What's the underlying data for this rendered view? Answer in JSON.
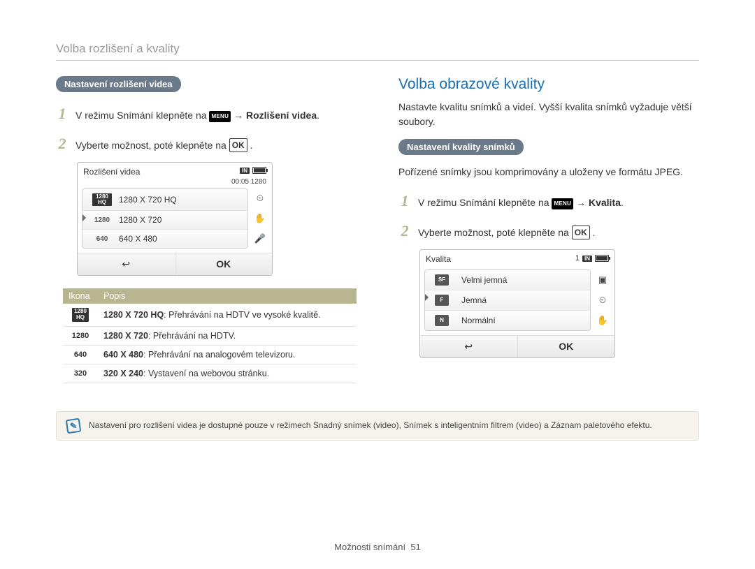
{
  "page_heading": "Volba rozlišení a kvality",
  "left": {
    "pill": "Nastavení rozlišení videa",
    "step1_pre": "V režimu Snímání klepněte na",
    "step1_menu": "MENU",
    "step1_post": "→ Rozlišení videa",
    "step2_pre": "Vyberte možnost, poté klepněte na",
    "step2_ok": "OK",
    "lcd": {
      "title": "Rozlišení videa",
      "in_label": "IN",
      "sub": "00:05  1280",
      "rows": [
        {
          "icon": "1280\nHQ",
          "label": "1280 X 720 HQ",
          "hq": true,
          "selected": false
        },
        {
          "icon": "1280",
          "label": "1280 X 720",
          "hq": false,
          "selected": true
        },
        {
          "icon": "640",
          "label": "640 X 480",
          "hq": false,
          "selected": false
        }
      ],
      "back": "↩",
      "ok": "OK"
    },
    "table": {
      "h_icon": "Ikona",
      "h_desc": "Popis",
      "rows": [
        {
          "icon": "1280 HQ",
          "hq": true,
          "bold": "1280 X 720 HQ",
          "rest": ": Přehrávání na HDTV ve vysoké kvalitě."
        },
        {
          "icon": "1280",
          "hq": false,
          "bold": "1280 X 720",
          "rest": ": Přehrávání na HDTV."
        },
        {
          "icon": "640",
          "hq": false,
          "bold": "640 X 480",
          "rest": ": Přehrávání na analogovém televizoru."
        },
        {
          "icon": "320",
          "hq": false,
          "bold": "320 X 240",
          "rest": ": Vystavení na webovou stránku."
        }
      ]
    },
    "note": "Nastavení pro rozlišení videa je dostupné pouze v režimech Snadný snímek (video), Snímek s inteligentním filtrem (video) a Záznam paletového efektu."
  },
  "right": {
    "heading": "Volba obrazové kvality",
    "intro": "Nastavte kvalitu snímků a videí. Vyšší kvalita snímků vyžaduje větší soubory.",
    "pill": "Nastavení kvality snímků",
    "sub": "Pořízené snímky jsou komprimovány a uloženy ve formátu JPEG.",
    "step1_pre": "V režimu Snímání klepněte na",
    "step1_menu": "MENU",
    "step1_post": "→ Kvalita",
    "step2_pre": "Vyberte možnost, poté klepněte na",
    "step2_ok": "OK",
    "lcd": {
      "title": "Kvalita",
      "in_label": "IN",
      "top_right_num": "1",
      "rows": [
        {
          "glyph": "SF",
          "label": "Velmi jemná",
          "selected": false
        },
        {
          "glyph": "F",
          "label": "Jemná",
          "selected": true
        },
        {
          "glyph": "N",
          "label": "Normální",
          "selected": false
        }
      ],
      "back": "↩",
      "ok": "OK"
    }
  },
  "footer_label": "Možnosti snímání",
  "footer_page": "51"
}
